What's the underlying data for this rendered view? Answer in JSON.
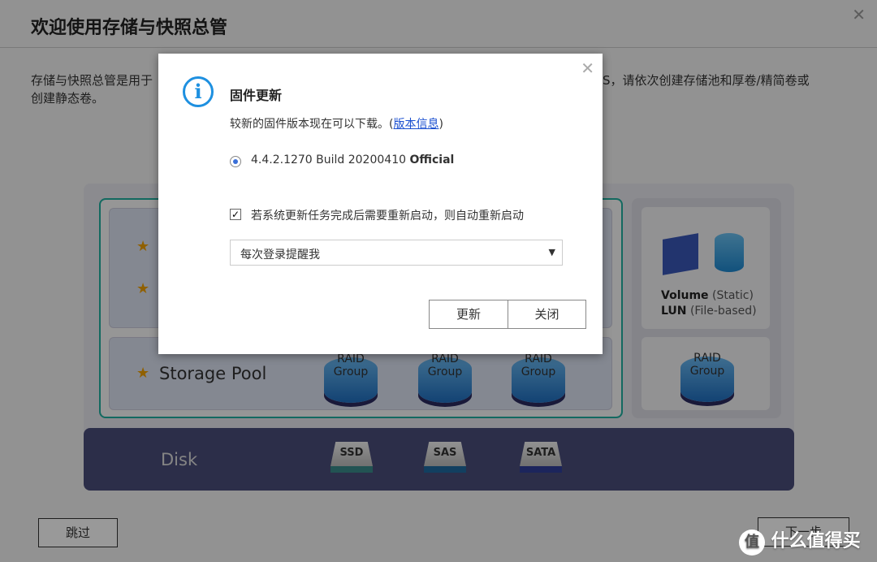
{
  "page": {
    "title": "欢迎使用存储与快照总管",
    "intro_left": "存储与快照总管是用于",
    "intro_right": "S，请依次创建存储池和厚卷/精简卷或",
    "intro_line2": "创建静态卷。",
    "skip": "跳过",
    "next": "下一步"
  },
  "diagram": {
    "storage_pool": "Storage Pool",
    "raid": "RAID",
    "group": "Group",
    "volume": "Volume",
    "static": "(Static)",
    "lun": "LUN",
    "file_based": "(File-based)",
    "disk": "Disk",
    "drives": [
      {
        "label": "SSD",
        "color": "#3a8a8a"
      },
      {
        "label": "SAS",
        "color": "#1f6aa0"
      },
      {
        "label": "SATA",
        "color": "#2f3f9a"
      }
    ]
  },
  "dialog": {
    "title": "固件更新",
    "message": "较新的固件版本现在可以下载。(",
    "link": "版本信息",
    "message_end": ")",
    "version": "4.4.2.1270 Build 20200410",
    "version_tag": "Official",
    "auto_restart": "若系统更新任务完成后需要重新启动，则自动重新启动",
    "remind_option": "每次登录提醒我",
    "update": "更新",
    "close": "关闭"
  },
  "watermark": "什么值得买"
}
